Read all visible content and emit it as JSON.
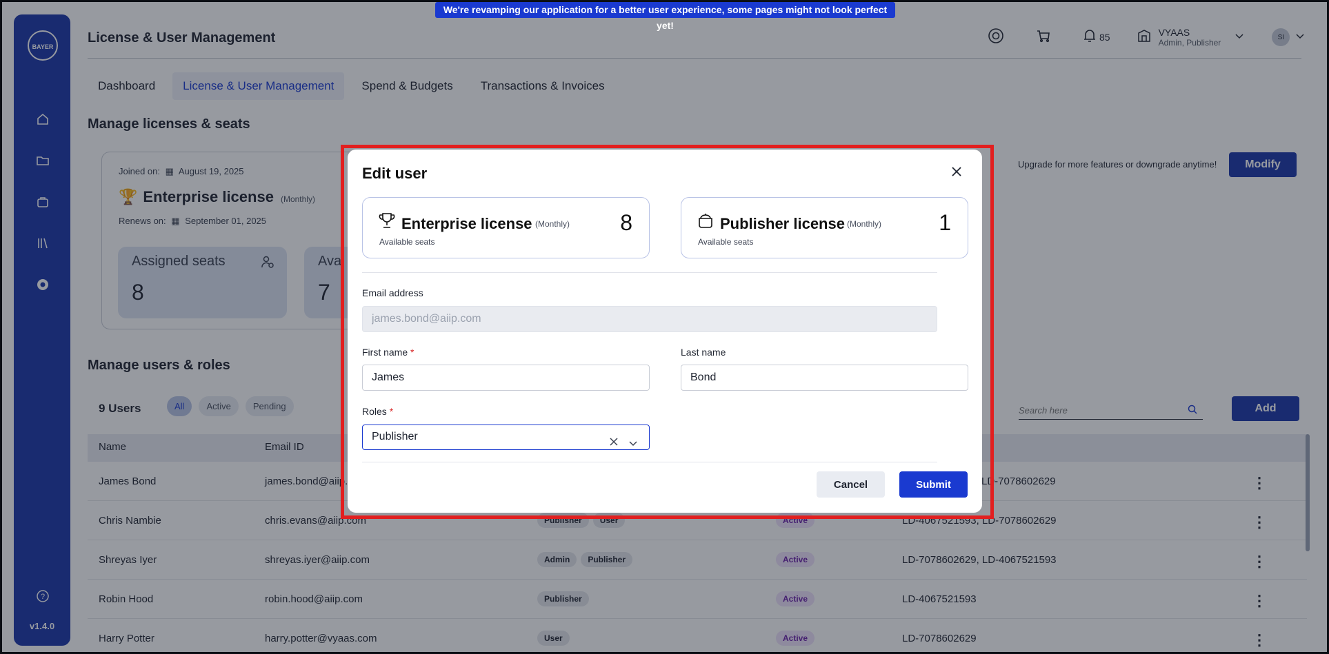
{
  "banner": {
    "text": "We're revamping our application for a better user experience, some pages might not look perfect yet!"
  },
  "sidebar": {
    "logo_text": "BAYER",
    "version": "v1.4.0"
  },
  "header": {
    "title": "License & User Management",
    "notifications_count": "85",
    "org_name": "VYAAS",
    "org_roles": "Admin, Publisher",
    "avatar_initials": "SI"
  },
  "tabs": [
    {
      "label": "Dashboard"
    },
    {
      "label": "License & User Management"
    },
    {
      "label": "Spend & Budgets"
    },
    {
      "label": "Transactions & Invoices"
    }
  ],
  "licenses_section": {
    "title": "Manage licenses & seats",
    "joined_label": "Joined on:",
    "joined_date": "August 19, 2025",
    "license_name": "Enterprise license",
    "license_period": "(Monthly)",
    "renews_label": "Renews on:",
    "renews_date": "September 01, 2025",
    "assigned_label": "Assigned seats",
    "assigned_value": "8",
    "available_label": "Ava",
    "available_value": "7",
    "upgrade_text": "Upgrade for more features or downgrade anytime!",
    "modify_label": "Modify"
  },
  "users_section": {
    "title": "Manage users & roles",
    "count_label": "9 Users",
    "filters": [
      "All",
      "Active",
      "Pending"
    ],
    "search_placeholder": "Search here",
    "add_label": "Add",
    "columns": [
      "Name",
      "Email ID"
    ],
    "rows": [
      {
        "name": "James Bond",
        "email": "james.bond@aiip.c",
        "roles": [],
        "status": "",
        "ids": "LD-7078602629"
      },
      {
        "name": "Chris Nambie",
        "email": "chris.evans@aiip.com",
        "roles": [
          "Publisher",
          "User"
        ],
        "status": "Active",
        "ids": "LD-4067521593, LD-7078602629"
      },
      {
        "name": "Shreyas Iyer",
        "email": "shreyas.iyer@aiip.com",
        "roles": [
          "Admin",
          "Publisher"
        ],
        "status": "Active",
        "ids": "LD-7078602629, LD-4067521593"
      },
      {
        "name": "Robin Hood",
        "email": "robin.hood@aiip.com",
        "roles": [
          "Publisher"
        ],
        "status": "Active",
        "ids": "LD-4067521593"
      },
      {
        "name": "Harry Potter",
        "email": "harry.potter@vyaas.com",
        "roles": [
          "User"
        ],
        "status": "Active",
        "ids": "LD-7078602629"
      }
    ]
  },
  "modal": {
    "title": "Edit user",
    "cards": [
      {
        "name": "Enterprise license",
        "period": "(Monthly)",
        "sub": "Available seats",
        "count": "8"
      },
      {
        "name": "Publisher license",
        "period": "(Monthly)",
        "sub": "Available seats",
        "count": "1"
      }
    ],
    "email_label": "Email address",
    "email_value": "james.bond@aiip.com",
    "first_name_label": "First name",
    "first_name_value": "James",
    "last_name_label": "Last name",
    "last_name_value": "Bond",
    "roles_label": "Roles",
    "roles_value": "Publisher",
    "required_mark": "*",
    "cancel_label": "Cancel",
    "submit_label": "Submit"
  },
  "colors": {
    "primary": "#1a3ad0",
    "sidebar": "#1a35a8",
    "highlight": "#e21f1f"
  }
}
